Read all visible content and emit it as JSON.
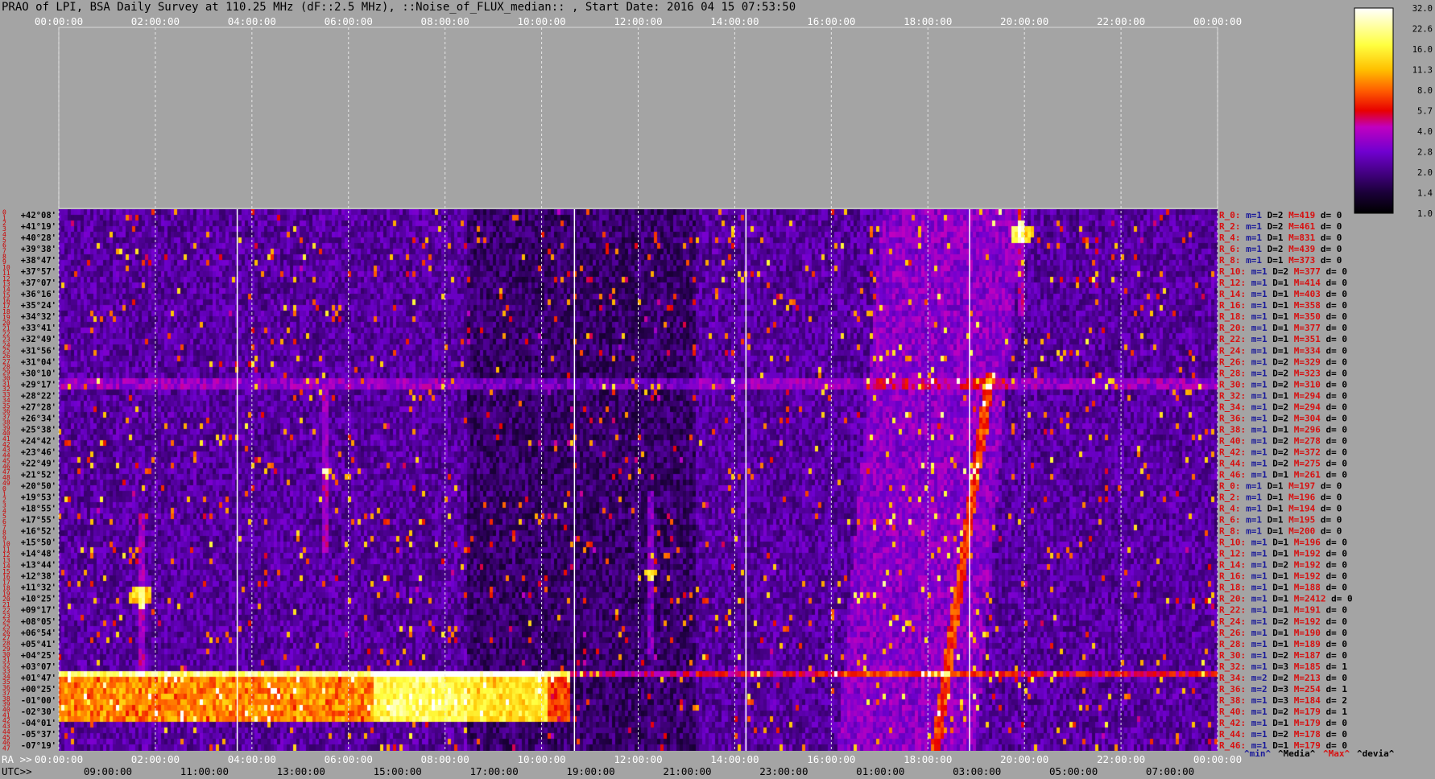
{
  "title": "PRAO of LPI, BSA Daily Survey at 110.25 MHz (dF::2.5 MHz), ::Noise_of_FLUX_median:: , Start Date: 2016 04 15 07:53:50",
  "colors": {
    "background": "#a4a4a4",
    "label_red": "#d81010",
    "label_blue": "#1a1a9a",
    "white": "#ffffff"
  },
  "chart_data": {
    "type": "heatmap",
    "colormap": "black-purple-red-yellow-white",
    "top_axis_ticks": [
      "00:00:00",
      "02:00:00",
      "04:00:00",
      "06:00:00",
      "08:00:00",
      "10:00:00",
      "12:00:00",
      "14:00:00",
      "16:00:00",
      "18:00:00",
      "20:00:00",
      "22:00:00",
      "00:00:00"
    ],
    "ra_axis_label": "RA >>",
    "ra_axis_ticks": [
      "00:00:00",
      "02:00:00",
      "04:00:00",
      "06:00:00",
      "08:00:00",
      "10:00:00",
      "12:00:00",
      "14:00:00",
      "16:00:00",
      "18:00:00",
      "20:00:00",
      "22:00:00",
      "00:00:00"
    ],
    "utc_axis_label": "UTC>>",
    "utc_axis_ticks": [
      "09:00:00",
      "11:00:00",
      "13:00:00",
      "15:00:00",
      "17:00:00",
      "19:00:00",
      "21:00:00",
      "23:00:00",
      "01:00:00",
      "03:00:00",
      "05:00:00",
      "07:00:00"
    ],
    "declination_labels": [
      "+42°08'",
      "+41°19'",
      "+40°28'",
      "+39°38'",
      "+38°47'",
      "+37°57'",
      "+37°07'",
      "+36°16'",
      "+35°24'",
      "+34°32'",
      "+33°41'",
      "+32°49'",
      "+31°56'",
      "+31°04'",
      "+30°10'",
      "+29°17'",
      "+28°22'",
      "+27°28'",
      "+26°34'",
      "+25°38'",
      "+24°42'",
      "+23°46'",
      "+22°49'",
      "+21°52'",
      "+20°50'",
      "+19°53'",
      "+18°55'",
      "+17°55'",
      "+16°52'",
      "+15°50'",
      "+14°48'",
      "+13°44'",
      "+12°38'",
      "+11°32'",
      "+10°25'",
      "+09°17'",
      "+08°05'",
      "+06°54'",
      "+05°41'",
      "+04°25'",
      "+03°07'",
      "+01°47'",
      "+00°25'",
      "-01°00'",
      "-02°30'",
      "-04°01'",
      "-05°37'",
      "-07°19'"
    ],
    "row_numbers": [
      "0",
      "1",
      "2",
      "3",
      "4",
      "5",
      "6",
      "7",
      "8",
      "9",
      "10",
      "11",
      "12",
      "13",
      "14",
      "15",
      "16",
      "17",
      "18",
      "19",
      "20",
      "21",
      "22",
      "23",
      "24",
      "25",
      "26",
      "27",
      "28",
      "29",
      "30",
      "31",
      "32",
      "33",
      "34",
      "35",
      "36",
      "37",
      "38",
      "39",
      "40",
      "41",
      "42",
      "43",
      "44",
      "45",
      "46",
      "47",
      "48",
      "49",
      "0",
      "1",
      "2",
      "3",
      "4",
      "5",
      "6",
      "7",
      "8",
      "9",
      "10",
      "11",
      "12",
      "13",
      "14",
      "15",
      "16",
      "17",
      "18",
      "19",
      "20",
      "21",
      "22",
      "23",
      "24",
      "25",
      "26",
      "27",
      "28",
      "29",
      "30",
      "31",
      "32",
      "33",
      "34",
      "35",
      "36",
      "37",
      "38",
      "39",
      "40",
      "41",
      "42",
      "43",
      "44",
      "45",
      "46",
      "47"
    ],
    "row_stats": [
      {
        "r": "R_0:",
        "m": "m=1",
        "D": "D=2",
        "M": "M=419",
        "d": "d= 0"
      },
      {
        "r": "R_2:",
        "m": "m=1",
        "D": "D=2",
        "M": "M=461",
        "d": "d= 0"
      },
      {
        "r": "R_4:",
        "m": "m=1",
        "D": "D=1",
        "M": "M=831",
        "d": "d= 0"
      },
      {
        "r": "R_6:",
        "m": "m=1",
        "D": "D=2",
        "M": "M=439",
        "d": "d= 0"
      },
      {
        "r": "R_8:",
        "m": "m=1",
        "D": "D=1",
        "M": "M=373",
        "d": "d= 0"
      },
      {
        "r": "R_10:",
        "m": "m=1",
        "D": "D=2",
        "M": "M=377",
        "d": "d= 0"
      },
      {
        "r": "R_12:",
        "m": "m=1",
        "D": "D=1",
        "M": "M=414",
        "d": "d= 0"
      },
      {
        "r": "R_14:",
        "m": "m=1",
        "D": "D=1",
        "M": "M=403",
        "d": "d= 0"
      },
      {
        "r": "R_16:",
        "m": "m=1",
        "D": "D=1",
        "M": "M=358",
        "d": "d= 0"
      },
      {
        "r": "R_18:",
        "m": "m=1",
        "D": "D=1",
        "M": "M=350",
        "d": "d= 0"
      },
      {
        "r": "R_20:",
        "m": "m=1",
        "D": "D=1",
        "M": "M=377",
        "d": "d= 0"
      },
      {
        "r": "R_22:",
        "m": "m=1",
        "D": "D=1",
        "M": "M=351",
        "d": "d= 0"
      },
      {
        "r": "R_24:",
        "m": "m=1",
        "D": "D=1",
        "M": "M=334",
        "d": "d= 0"
      },
      {
        "r": "R_26:",
        "m": "m=1",
        "D": "D=2",
        "M": "M=329",
        "d": "d= 0"
      },
      {
        "r": "R_28:",
        "m": "m=1",
        "D": "D=2",
        "M": "M=323",
        "d": "d= 0"
      },
      {
        "r": "R_30:",
        "m": "m=1",
        "D": "D=2",
        "M": "M=310",
        "d": "d= 0"
      },
      {
        "r": "R_32:",
        "m": "m=1",
        "D": "D=1",
        "M": "M=294",
        "d": "d= 0"
      },
      {
        "r": "R_34:",
        "m": "m=1",
        "D": "D=2",
        "M": "M=294",
        "d": "d= 0"
      },
      {
        "r": "R_36:",
        "m": "m=1",
        "D": "D=2",
        "M": "M=304",
        "d": "d= 0"
      },
      {
        "r": "R_38:",
        "m": "m=1",
        "D": "D=1",
        "M": "M=296",
        "d": "d= 0"
      },
      {
        "r": "R_40:",
        "m": "m=1",
        "D": "D=2",
        "M": "M=278",
        "d": "d= 0"
      },
      {
        "r": "R_42:",
        "m": "m=1",
        "D": "D=2",
        "M": "M=372",
        "d": "d= 0"
      },
      {
        "r": "R_44:",
        "m": "m=1",
        "D": "D=2",
        "M": "M=275",
        "d": "d= 0"
      },
      {
        "r": "R_46:",
        "m": "m=1",
        "D": "D=1",
        "M": "M=261",
        "d": "d= 0"
      },
      {
        "r": "R_0:",
        "m": "m=1",
        "D": "D=1",
        "M": "M=197",
        "d": "d= 0"
      },
      {
        "r": "R_2:",
        "m": "m=1",
        "D": "D=1",
        "M": "M=196",
        "d": "d= 0"
      },
      {
        "r": "R_4:",
        "m": "m=1",
        "D": "D=1",
        "M": "M=194",
        "d": "d= 0"
      },
      {
        "r": "R_6:",
        "m": "m=1",
        "D": "D=1",
        "M": "M=195",
        "d": "d= 0"
      },
      {
        "r": "R_8:",
        "m": "m=1",
        "D": "D=1",
        "M": "M=200",
        "d": "d= 0"
      },
      {
        "r": "R_10:",
        "m": "m=1",
        "D": "D=1",
        "M": "M=196",
        "d": "d= 0"
      },
      {
        "r": "R_12:",
        "m": "m=1",
        "D": "D=1",
        "M": "M=192",
        "d": "d= 0"
      },
      {
        "r": "R_14:",
        "m": "m=1",
        "D": "D=2",
        "M": "M=192",
        "d": "d= 0"
      },
      {
        "r": "R_16:",
        "m": "m=1",
        "D": "D=1",
        "M": "M=192",
        "d": "d= 0"
      },
      {
        "r": "R_18:",
        "m": "m=1",
        "D": "D=1",
        "M": "M=188",
        "d": "d= 0"
      },
      {
        "r": "R_20:",
        "m": "m=1",
        "D": "D=1",
        "M": "M=2412",
        "d": "d= 0"
      },
      {
        "r": "R_22:",
        "m": "m=1",
        "D": "D=1",
        "M": "M=191",
        "d": "d= 0"
      },
      {
        "r": "R_24:",
        "m": "m=1",
        "D": "D=2",
        "M": "M=192",
        "d": "d= 0"
      },
      {
        "r": "R_26:",
        "m": "m=1",
        "D": "D=1",
        "M": "M=190",
        "d": "d= 0"
      },
      {
        "r": "R_28:",
        "m": "m=1",
        "D": "D=1",
        "M": "M=189",
        "d": "d= 0"
      },
      {
        "r": "R_30:",
        "m": "m=1",
        "D": "D=2",
        "M": "M=187",
        "d": "d= 0"
      },
      {
        "r": "R_32:",
        "m": "m=1",
        "D": "D=3",
        "M": "M=185",
        "d": "d= 1"
      },
      {
        "r": "R_34:",
        "m": "m=2",
        "D": "D=2",
        "M": "M=213",
        "d": "d= 0"
      },
      {
        "r": "R_36:",
        "m": "m=2",
        "D": "D=3",
        "M": "M=254",
        "d": "d= 1"
      },
      {
        "r": "R_38:",
        "m": "m=1",
        "D": "D=3",
        "M": "M=184",
        "d": "d= 2"
      },
      {
        "r": "R_40:",
        "m": "m=1",
        "D": "D=2",
        "M": "M=179",
        "d": "d= 1"
      },
      {
        "r": "R_42:",
        "m": "m=1",
        "D": "D=1",
        "M": "M=179",
        "d": "d= 0"
      },
      {
        "r": "R_44:",
        "m": "m=1",
        "D": "D=2",
        "M": "M=178",
        "d": "d= 0"
      },
      {
        "r": "R_46:",
        "m": "m=1",
        "D": "D=1",
        "M": "M=179",
        "d": "d= 0"
      }
    ],
    "footer_legend": [
      {
        "text": "^min^",
        "color": "#1a1a9a"
      },
      {
        "text": "^Media^",
        "color": "#000000"
      },
      {
        "text": "^Max^",
        "color": "#d81010"
      },
      {
        "text": "^devia^",
        "color": "#000000"
      }
    ],
    "colorbar_ticks": [
      "32.0",
      "22.6",
      "16.0",
      "11.3",
      "8.0",
      "5.7",
      "4.0",
      "2.8",
      "2.0",
      "1.4",
      "1.0"
    ]
  }
}
